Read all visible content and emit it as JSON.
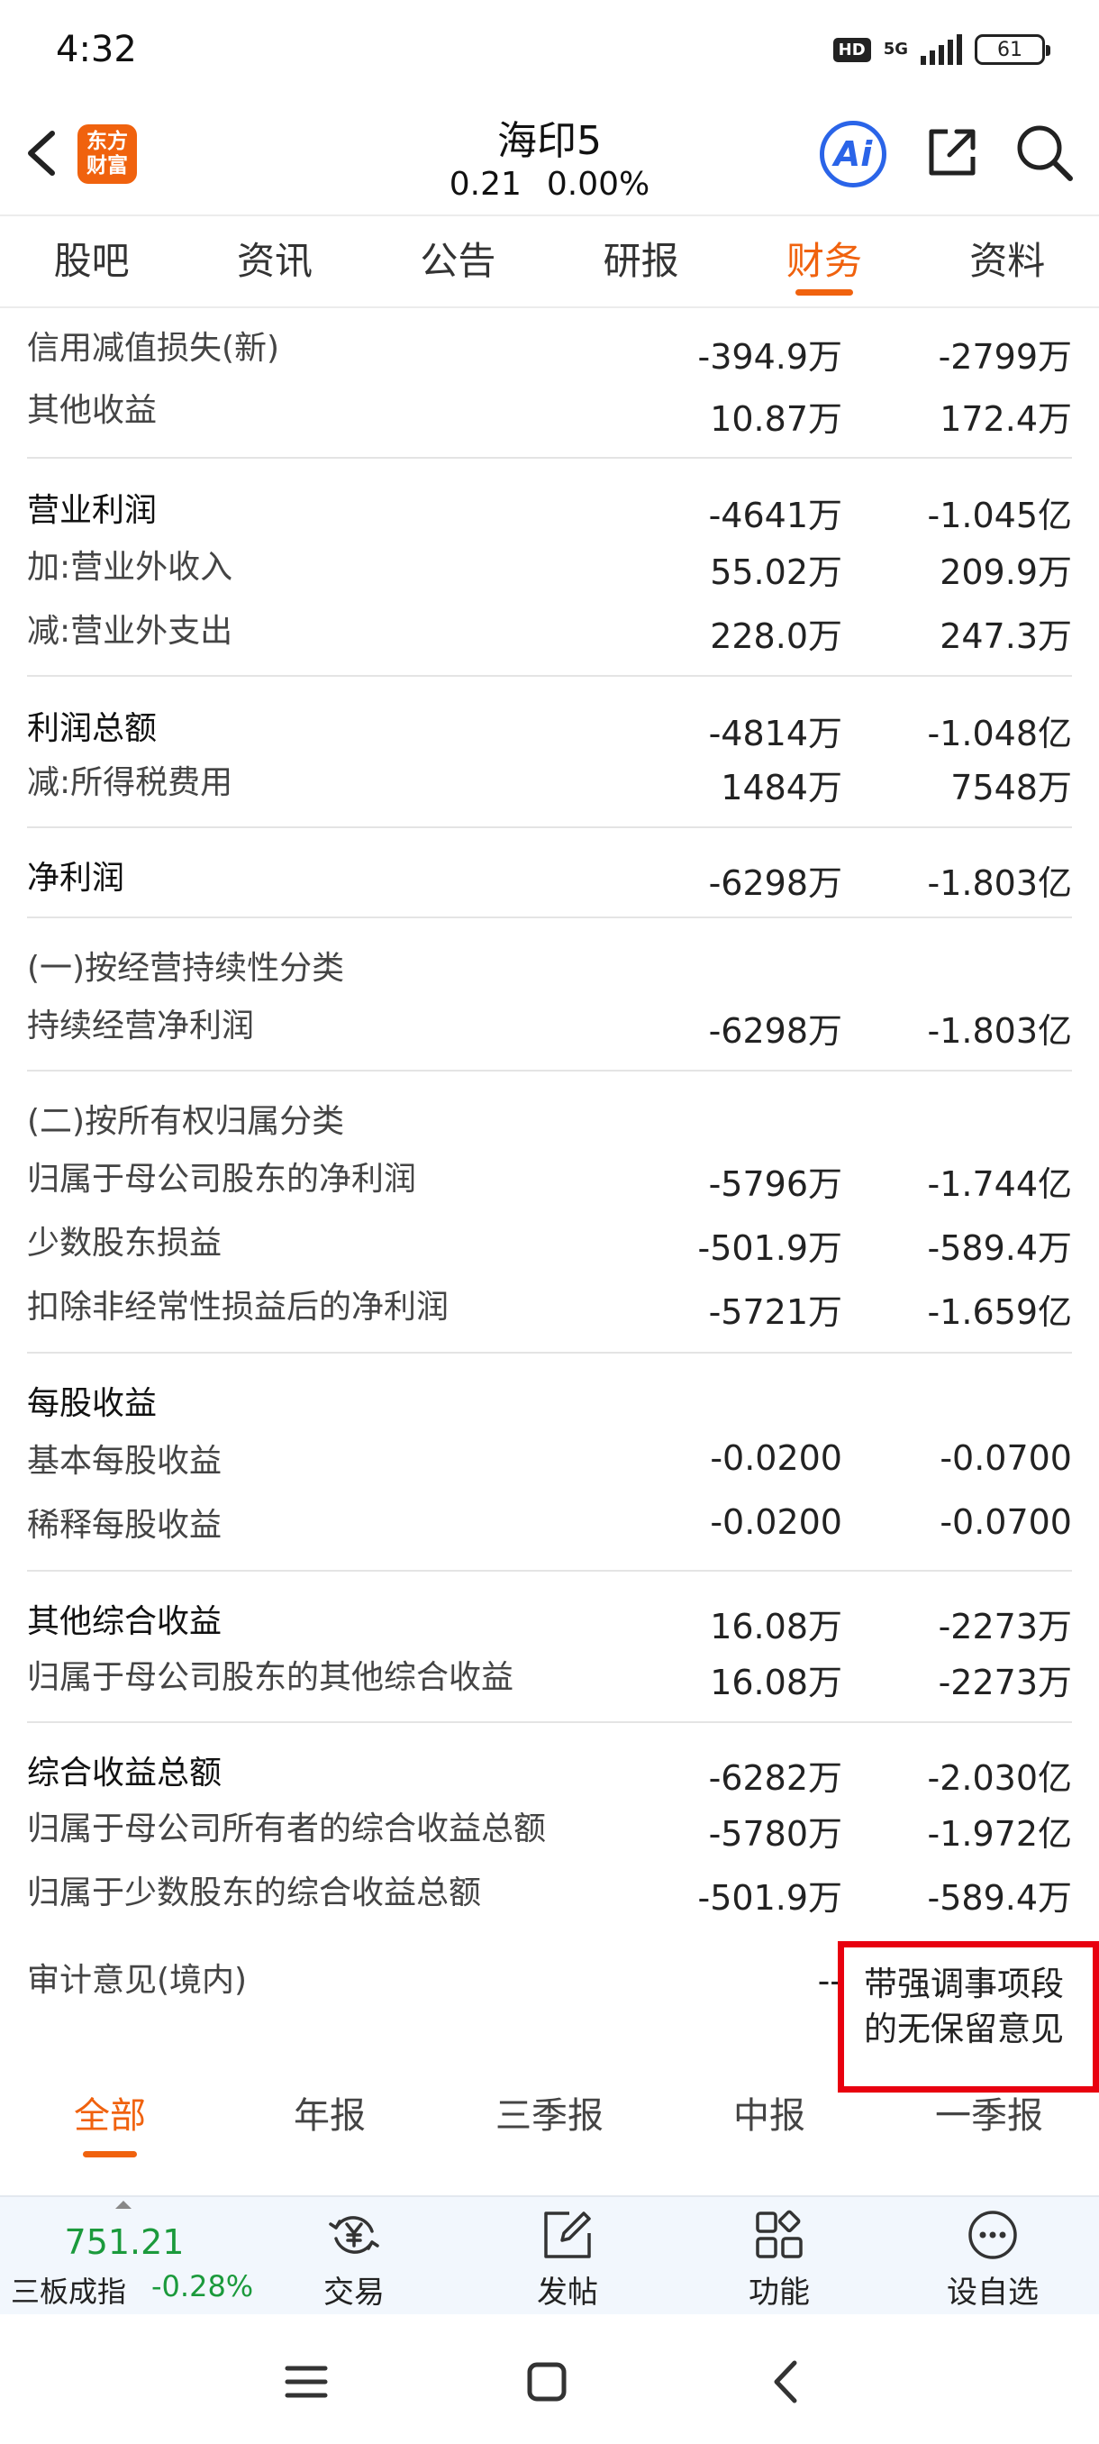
{
  "status_bar": {
    "time": "4:32",
    "hd": "HD",
    "network": "5G",
    "battery": "61"
  },
  "header": {
    "logo_line1": "东方",
    "logo_line2": "财富",
    "stock_name": "海印5",
    "price": "0.21",
    "change_pct": "0.00%",
    "ai_label": "Ai"
  },
  "tabs": [
    {
      "label": "股吧"
    },
    {
      "label": "资讯"
    },
    {
      "label": "公告"
    },
    {
      "label": "研报"
    },
    {
      "label": "财务"
    },
    {
      "label": "资料"
    }
  ],
  "rows": [
    {
      "label": "信用减值损失(新)",
      "v1": "-394.9万",
      "v2": "-2799万"
    },
    {
      "label": "其他收益",
      "v1": "10.87万",
      "v2": "172.4万"
    },
    {
      "label": "营业利润",
      "v1": "-4641万",
      "v2": "-1.045亿"
    },
    {
      "label": "加:营业外收入",
      "v1": "55.02万",
      "v2": "209.9万"
    },
    {
      "label": "减:营业外支出",
      "v1": "228.0万",
      "v2": "247.3万"
    },
    {
      "label": "利润总额",
      "v1": "-4814万",
      "v2": "-1.048亿"
    },
    {
      "label": "减:所得税费用",
      "v1": "1484万",
      "v2": "7548万"
    },
    {
      "label": "净利润",
      "v1": "-6298万",
      "v2": "-1.803亿"
    },
    {
      "label": "(一)按经营持续性分类",
      "v1": "",
      "v2": ""
    },
    {
      "label": "持续经营净利润",
      "v1": "-6298万",
      "v2": "-1.803亿"
    },
    {
      "label": "(二)按所有权归属分类",
      "v1": "",
      "v2": ""
    },
    {
      "label": "归属于母公司股东的净利润",
      "v1": "-5796万",
      "v2": "-1.744亿"
    },
    {
      "label": "少数股东损益",
      "v1": "-501.9万",
      "v2": "-589.4万"
    },
    {
      "label": "扣除非经常性损益后的净利润",
      "v1": "-5721万",
      "v2": "-1.659亿"
    },
    {
      "label": "每股收益",
      "v1": "",
      "v2": ""
    },
    {
      "label": "基本每股收益",
      "v1": "-0.0200",
      "v2": "-0.0700"
    },
    {
      "label": "稀释每股收益",
      "v1": "-0.0200",
      "v2": "-0.0700"
    },
    {
      "label": "其他综合收益",
      "v1": "16.08万",
      "v2": "-2273万"
    },
    {
      "label": "归属于母公司股东的其他综合收益",
      "v1": "16.08万",
      "v2": "-2273万"
    },
    {
      "label": "综合收益总额",
      "v1": "-6282万",
      "v2": "-2.030亿"
    },
    {
      "label": "归属于母公司所有者的综合收益总额",
      "v1": "-5780万",
      "v2": "-1.972亿"
    },
    {
      "label": "归属于少数股东的综合收益总额",
      "v1": "-501.9万",
      "v2": "-589.4万"
    }
  ],
  "audit": {
    "label": "审计意见(境内)",
    "v1": "--",
    "v2_line1": "带强调事项段",
    "v2_line2": "的无保留意见"
  },
  "period_tabs": [
    {
      "label": "全部"
    },
    {
      "label": "年报"
    },
    {
      "label": "三季报"
    },
    {
      "label": "中报"
    },
    {
      "label": "一季报"
    }
  ],
  "bottom_nav": {
    "index_value": "751.21",
    "index_name": "三板成指",
    "index_change": "-0.28%",
    "items": [
      {
        "label": "交易",
        "icon": "yen-exchange-icon"
      },
      {
        "label": "发帖",
        "icon": "edit-post-icon"
      },
      {
        "label": "功能",
        "icon": "grid-apps-icon"
      },
      {
        "label": "设自选",
        "icon": "more-dots-icon"
      }
    ]
  },
  "colors": {
    "accent": "#f0620e",
    "ai_blue": "#2a64e8",
    "down_green": "#1b9a3c",
    "highlight_red": "#e8000f"
  }
}
